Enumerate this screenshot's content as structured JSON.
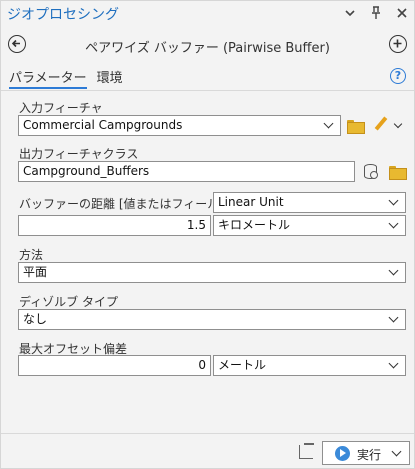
{
  "pane": {
    "title": "ジオプロセシング",
    "icons": [
      "chevron-down-icon",
      "pin-icon",
      "close-icon"
    ]
  },
  "tool": {
    "title": "ペアワイズ バッファー (Pairwise Buffer)"
  },
  "tabs": [
    {
      "label": "パラメーター",
      "active": true
    },
    {
      "label": "環境",
      "active": false
    }
  ],
  "params": {
    "input": {
      "label": "入力フィーチャ",
      "value": "Commercial Campgrounds"
    },
    "output": {
      "label": "出力フィーチャクラス",
      "value": "Campground_Buffers"
    },
    "distance": {
      "label": "バッファーの距離 [値またはフィールド]",
      "type_value": "Linear Unit",
      "value": "1.5",
      "unit": "キロメートル"
    },
    "method": {
      "label": "方法",
      "value": "平面"
    },
    "dissolve": {
      "label": "ディゾルブ タイプ",
      "value": "なし"
    },
    "offset": {
      "label": "最大オフセット偏差",
      "value": "0",
      "unit": "メートル"
    }
  },
  "footer": {
    "run_label": "実行"
  },
  "colors": {
    "accent": "#2d7bd6",
    "title": "#1f6fbf",
    "folder": "#e8b930",
    "run_icon": "#3b8ad9"
  }
}
